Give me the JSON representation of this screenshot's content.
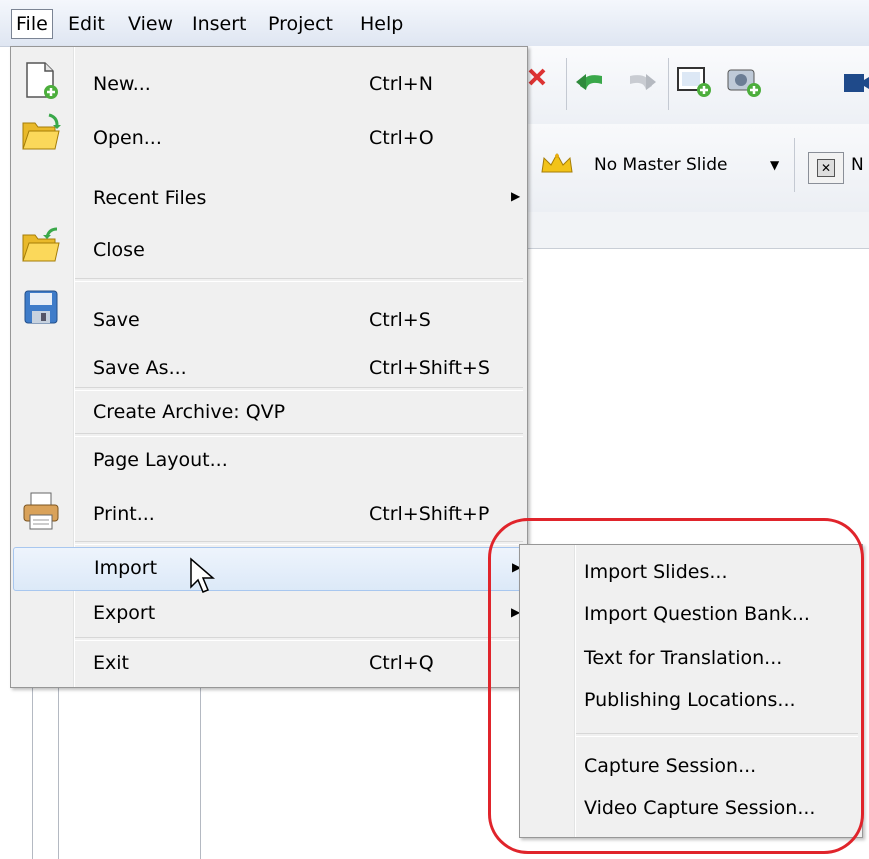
{
  "menubar": {
    "items": [
      "File",
      "Edit",
      "View",
      "Insert",
      "Project",
      "Help"
    ]
  },
  "toolbar": {
    "master_slide_label": "No Master Slide",
    "partial_label": "N"
  },
  "file_menu": {
    "items": [
      {
        "label": "New...",
        "shortcut": "Ctrl+N",
        "icon": "new-document-icon"
      },
      {
        "label": "Open...",
        "shortcut": "Ctrl+O",
        "icon": "open-folder-icon"
      },
      {
        "label": "Recent Files",
        "shortcut": "",
        "has_submenu": true
      },
      {
        "label": "Close",
        "shortcut": "",
        "icon": "close-folder-icon"
      },
      {
        "label": "Save",
        "shortcut": "Ctrl+S",
        "icon": "save-disk-icon"
      },
      {
        "label": "Save As...",
        "shortcut": "Ctrl+Shift+S"
      },
      {
        "label": "Create Archive: QVP",
        "shortcut": ""
      },
      {
        "label": "Page Layout...",
        "shortcut": ""
      },
      {
        "label": "Print...",
        "shortcut": "Ctrl+Shift+P",
        "icon": "printer-icon"
      },
      {
        "label": "Import",
        "shortcut": "",
        "has_submenu": true,
        "highlighted": true
      },
      {
        "label": "Export",
        "shortcut": "",
        "has_submenu": true
      },
      {
        "label": "Exit",
        "shortcut": "Ctrl+Q"
      }
    ]
  },
  "import_submenu": {
    "items": [
      "Import Slides...",
      "Import Question Bank...",
      "Text for Translation...",
      "Publishing Locations...",
      "Capture Session...",
      "Video Capture Session..."
    ]
  },
  "colors": {
    "highlight_border": "#a8c7ef",
    "callout": "#e0242b",
    "menu_bg": "#f0f0f0"
  }
}
